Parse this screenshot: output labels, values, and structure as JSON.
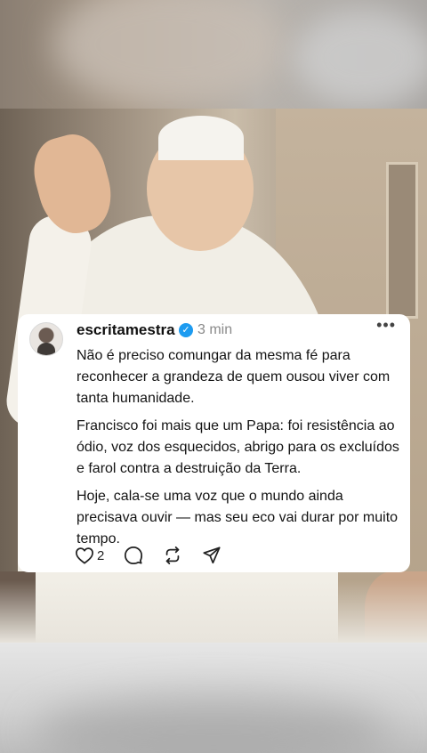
{
  "post": {
    "username": "escritamestra",
    "time": "3 min",
    "more_label": "•••",
    "paragraphs": [
      "Não é preciso comungar da mesma fé para reconhecer a grandeza de quem ousou viver com tanta humanidade.",
      "Francisco foi mais que um Papa: foi resistência ao ódio, voz dos esquecidos, abrigo para os excluídos e farol contra a destruição da Terra.",
      "Hoje, cala-se uma voz que o mundo ainda precisava ouvir — mas seu eco vai durar por muito tempo."
    ],
    "verified_glyph": "✓",
    "likes": "2",
    "icons": [
      "heart-icon",
      "comment-icon",
      "repost-icon",
      "share-icon"
    ],
    "colors": {
      "verified": "#1d9bf0",
      "card": "#ffffff",
      "text": "#141414"
    }
  }
}
